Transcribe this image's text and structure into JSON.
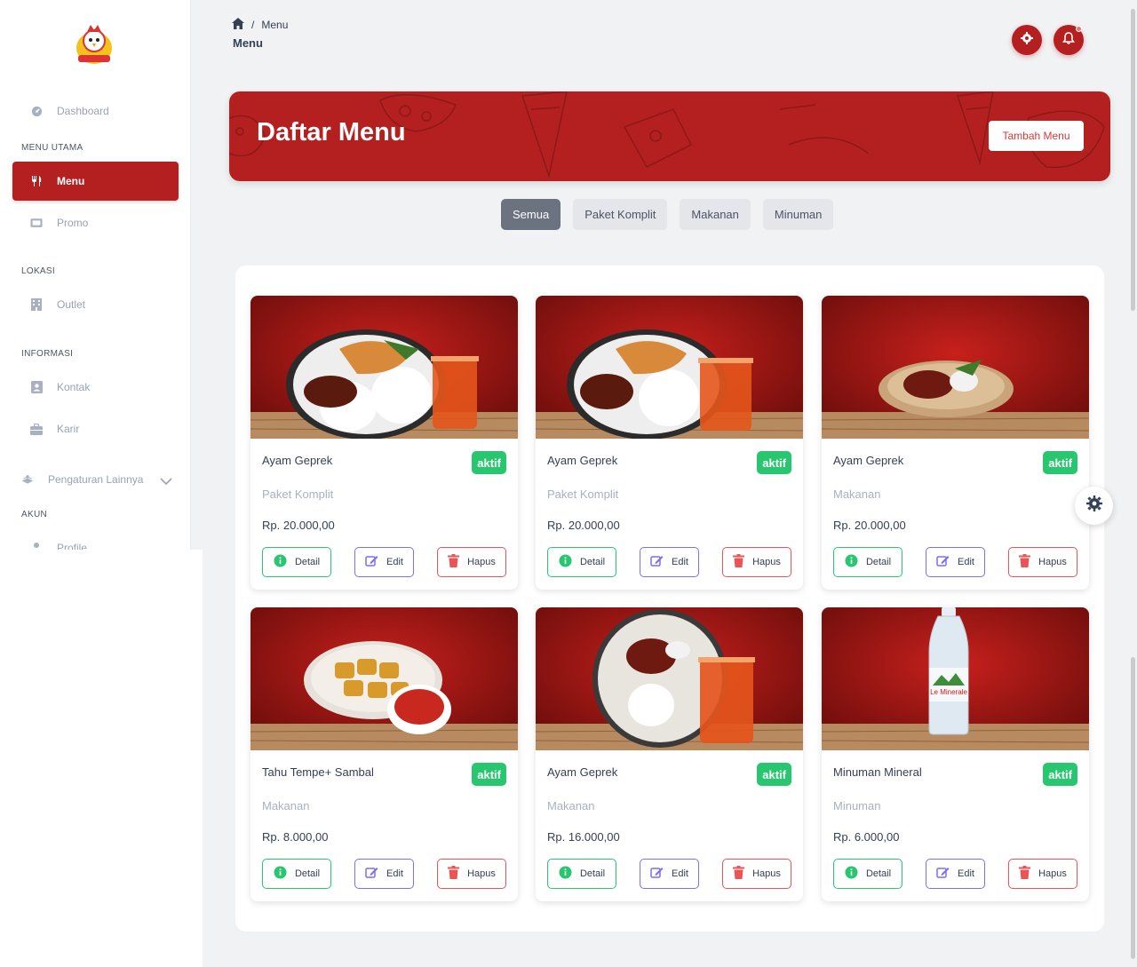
{
  "sidebar": {
    "logo_icon": "chicken-mascot-logo",
    "items": [
      {
        "label": "Dashboard",
        "icon": "dashboard-icon"
      },
      {
        "label": "Menu",
        "icon": "utensils-icon",
        "active": true
      },
      {
        "label": "Promo",
        "icon": "ticket-icon"
      },
      {
        "label": "Outlet",
        "icon": "building-icon"
      },
      {
        "label": "Kontak",
        "icon": "contact-icon"
      },
      {
        "label": "Karir",
        "icon": "briefcase-icon"
      },
      {
        "label": "Pengaturan Lainnya",
        "icon": "settings-stack-icon"
      },
      {
        "label": "Profile",
        "icon": "user-icon"
      }
    ],
    "sections": {
      "menu_utama": "MENU UTAMA",
      "lokasi": "LOKASI",
      "informasi": "INFORMASI",
      "akun": "AKUN"
    }
  },
  "header": {
    "breadcrumb_current": "Menu",
    "page_title": "Menu"
  },
  "banner": {
    "title": "Daftar Menu",
    "add_button": "Tambah Menu"
  },
  "filters": [
    "Semua",
    "Paket Komplit",
    "Makanan",
    "Minuman"
  ],
  "active_filter": "Semua",
  "buttons": {
    "detail": "Detail",
    "edit": "Edit",
    "hapus": "Hapus"
  },
  "cards": [
    {
      "name": "Ayam Geprek",
      "status": "aktif",
      "category": "Paket Komplit",
      "price": "Rp. 20.000,00",
      "image": "ayam-geprek-paket-photo"
    },
    {
      "name": "Ayam Geprek",
      "status": "aktif",
      "category": "Paket Komplit",
      "price": "Rp. 20.000,00",
      "image": "ayam-geprek-paket-photo"
    },
    {
      "name": "Ayam Geprek",
      "status": "aktif",
      "category": "Makanan",
      "price": "Rp. 20.000,00",
      "image": "ayam-geprek-plate-photo"
    },
    {
      "name": "Tahu Tempe+ Sambal",
      "status": "aktif",
      "category": "Makanan",
      "price": "Rp. 8.000,00",
      "image": "tahu-tempe-sambal-photo"
    },
    {
      "name": "Ayam Geprek",
      "status": "aktif",
      "category": "Makanan",
      "price": "Rp. 16.000,00",
      "image": "ayam-geprek-tea-photo"
    },
    {
      "name": "Minuman Mineral",
      "status": "aktif",
      "category": "Minuman",
      "price": "Rp. 6.000,00",
      "image": "mineral-water-bottle-photo"
    }
  ],
  "colors": {
    "primary": "#b3201f",
    "badge_green": "#28c76f",
    "edit_purple": "#7c6ff0",
    "delete_red": "#ea5455"
  }
}
